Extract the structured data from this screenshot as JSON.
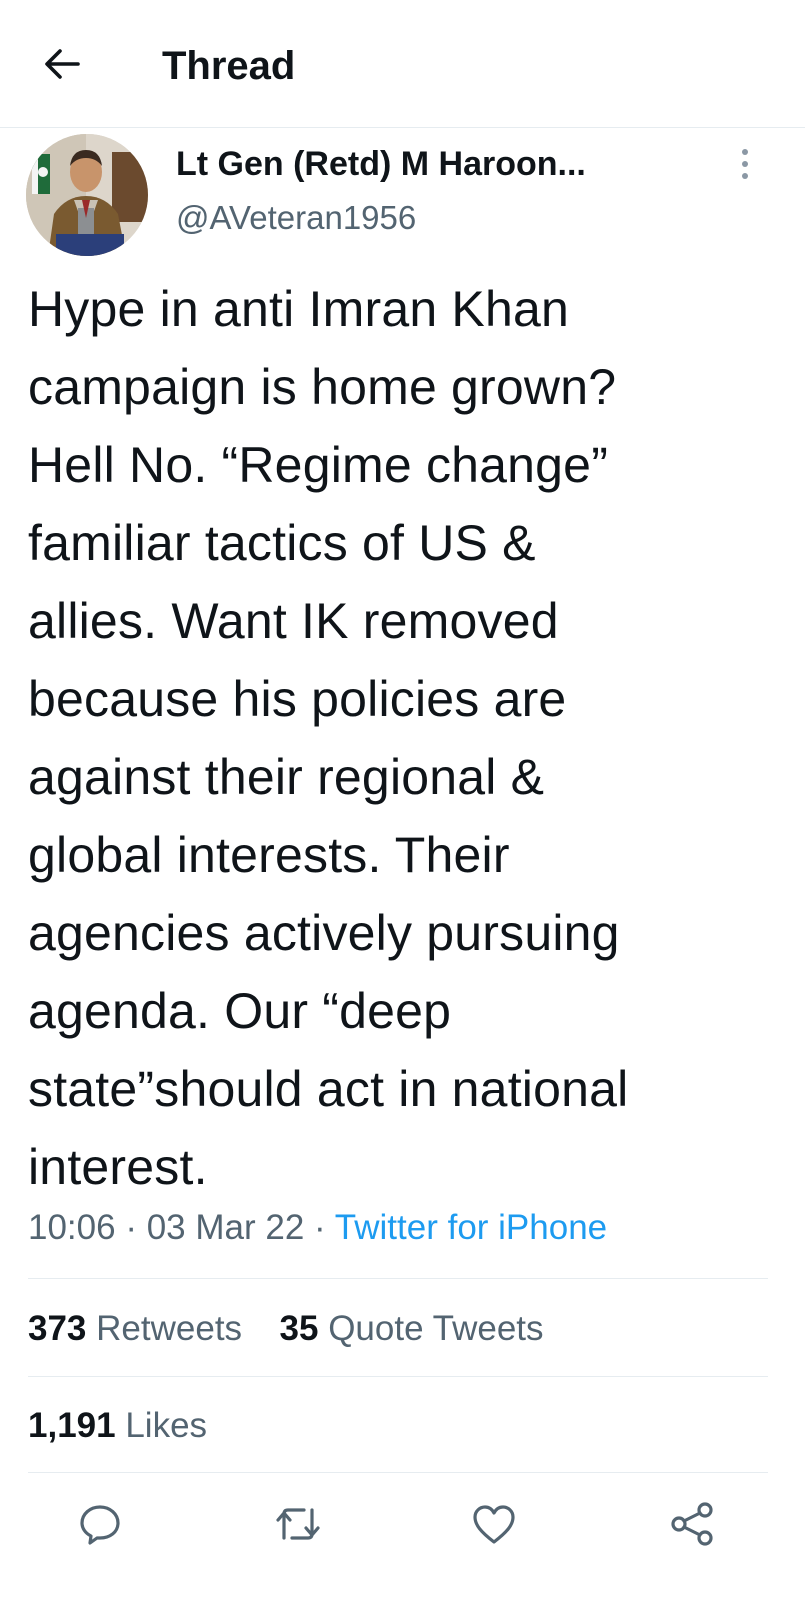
{
  "header": {
    "title": "Thread",
    "back_icon": "arrow-left-icon"
  },
  "author": {
    "name": "Lt Gen (Retd) M Haroon...",
    "handle": "@AVeteran1956",
    "more_icon": "more-vertical-icon"
  },
  "tweet": {
    "text": "Hype in anti Imran Khan\ncampaign is home grown?\nHell No. “Regime change”\nfamiliar tactics of US &\nallies. Want IK removed\nbecause his policies are\nagainst their regional &\nglobal interests. Their\nagencies actively pursuing\nagenda. Our “deep\nstate”should act in national\ninterest.",
    "time": "10:06",
    "separator": "·",
    "date": "03 Mar 22",
    "source": "Twitter for iPhone"
  },
  "stats": {
    "retweets_count": "373",
    "retweets_label": "Retweets",
    "quotes_count": "35",
    "quotes_label": "Quote Tweets",
    "likes_count": "1,191",
    "likes_label": "Likes"
  },
  "actions": [
    {
      "icon": "reply-icon"
    },
    {
      "icon": "retweet-icon"
    },
    {
      "icon": "like-icon"
    },
    {
      "icon": "share-icon"
    }
  ],
  "colors": {
    "text": "#0f1419",
    "secondary": "#536471",
    "link": "#1d9bf0",
    "divider": "#e6ecf0"
  }
}
